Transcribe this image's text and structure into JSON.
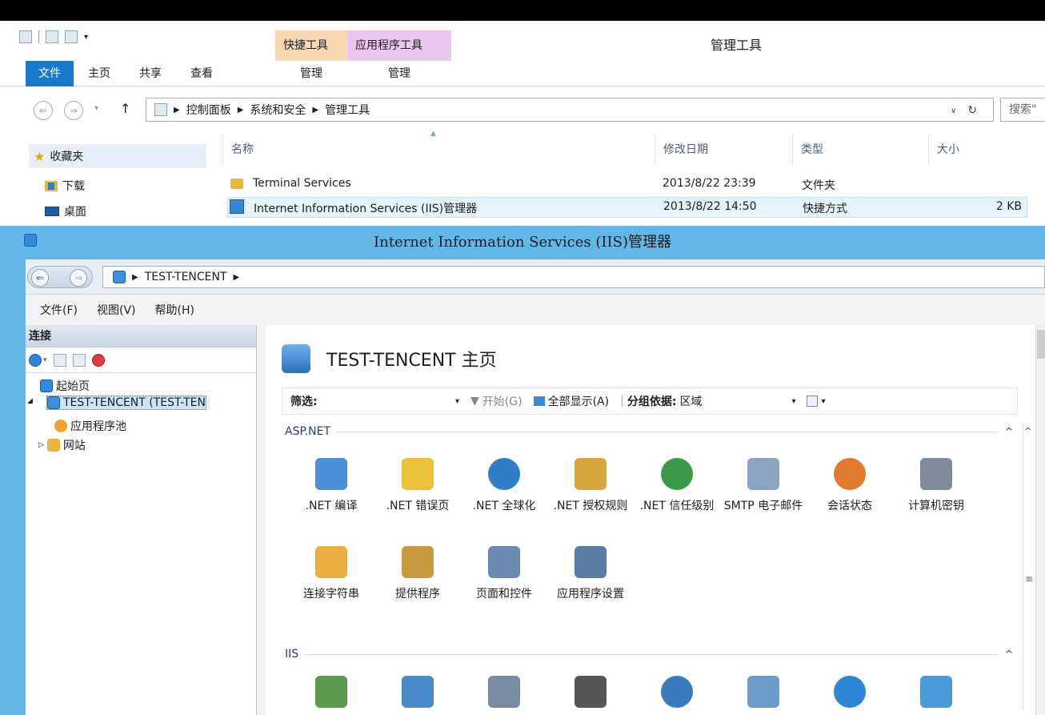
{
  "explorer": {
    "ctx_tab_shortcut": "快捷工具",
    "ctx_tab_app": "应用程序工具",
    "window_title": "管理工具",
    "ribbon": {
      "file": "文件",
      "home": "主页",
      "share": "共享",
      "view": "查看",
      "manage1": "管理",
      "manage2": "管理"
    },
    "address": {
      "crumbs": [
        "控制面板",
        "系统和安全",
        "管理工具"
      ],
      "search_placeholder": "搜索\""
    },
    "nav": {
      "favorites": "收藏夹",
      "downloads": "下载",
      "desktop": "桌面"
    },
    "columns": {
      "name": "名称",
      "modified": "修改日期",
      "type": "类型",
      "size": "大小"
    },
    "files": [
      {
        "name": "Terminal Services",
        "modified": "2013/8/22 23:39",
        "type": "文件夹",
        "size": ""
      },
      {
        "name": "Internet Information Services (IIS)管理器",
        "modified": "2013/8/22 14:50",
        "type": "快捷方式",
        "size": "2 KB"
      }
    ]
  },
  "iis": {
    "window_title": "Internet Information Services (IIS)管理器",
    "address": {
      "server": "TEST-TENCENT"
    },
    "menu": {
      "file": "文件(F)",
      "view": "视图(V)",
      "help": "帮助(H)"
    },
    "connections": {
      "title": "连接",
      "tree": {
        "start_page": "起始页",
        "server": "TEST-TENCENT (TEST-TEN",
        "app_pools": "应用程序池",
        "sites": "网站"
      }
    },
    "features": {
      "title": "TEST-TENCENT 主页",
      "filter": {
        "label": "筛选:",
        "start": "开始(G)",
        "show_all": "全部显示(A)",
        "group_by_label": "分组依据:",
        "group_by_value": "区域"
      },
      "groups": {
        "aspnet": "ASP.NET",
        "iis": "IIS"
      },
      "aspnet_tiles": [
        {
          "label": ".NET 编译",
          "color": "#4a90d9"
        },
        {
          "label": ".NET 错误页",
          "color": "#e9c23a"
        },
        {
          "label": ".NET 全球化",
          "color": "#2f7fc8"
        },
        {
          "label": ".NET 授权规则",
          "color": "#d8a640"
        },
        {
          "label": ".NET 信任级别",
          "color": "#3a9a4a"
        },
        {
          "label": "SMTP 电子邮件",
          "color": "#8aa4c0"
        },
        {
          "label": "会话状态",
          "color": "#e07a30"
        },
        {
          "label": "计算机密钥",
          "color": "#7f8a99"
        },
        {
          "label": "连接字符串",
          "color": "#e8b040"
        },
        {
          "label": "提供程序",
          "color": "#c89a40"
        },
        {
          "label": "页面和控件",
          "color": "#6a8ab0"
        },
        {
          "label": "应用程序设置",
          "color": "#5a7fa6"
        }
      ]
    }
  }
}
